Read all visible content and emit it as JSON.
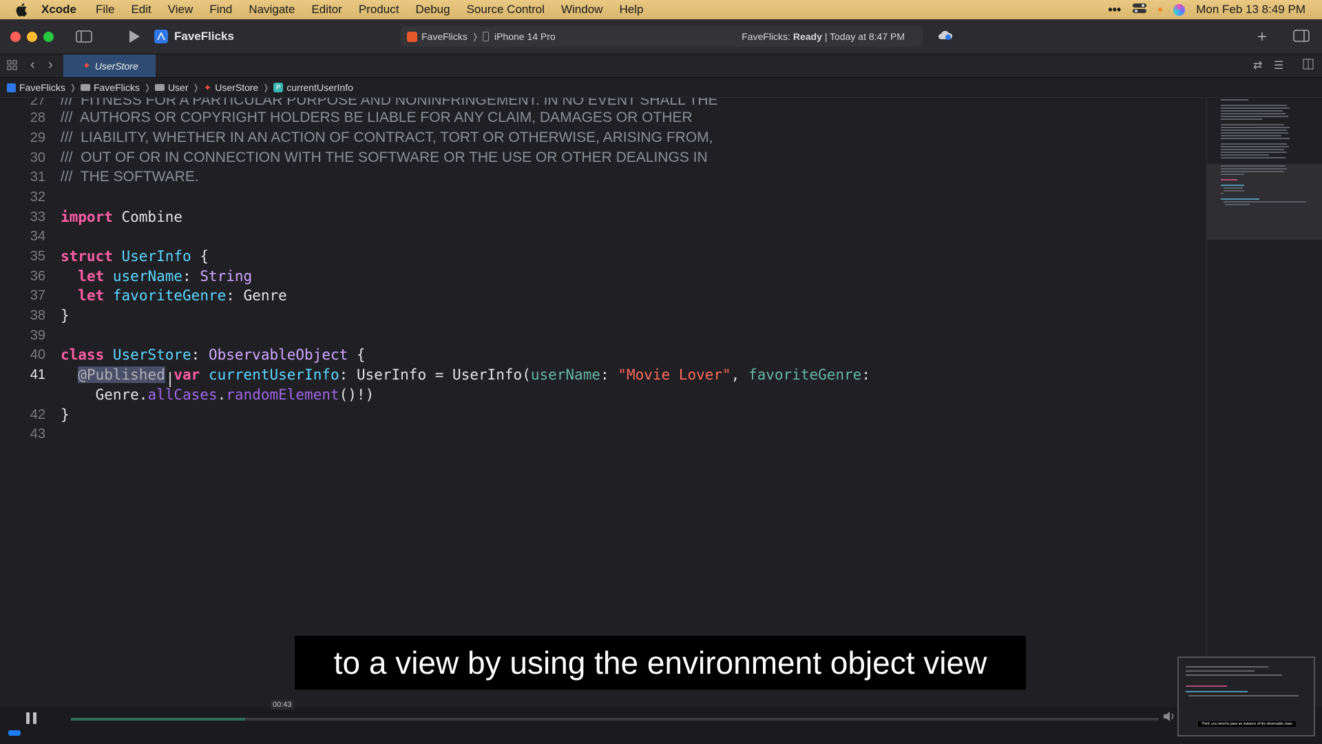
{
  "menubar": {
    "app_name": "Xcode",
    "items": [
      "File",
      "Edit",
      "View",
      "Find",
      "Navigate",
      "Editor",
      "Product",
      "Debug",
      "Source Control",
      "Window",
      "Help"
    ],
    "clock": "Mon Feb 13  8:49 PM"
  },
  "toolbar": {
    "project_title": "FaveFlicks",
    "scheme": "FaveFlicks",
    "device": "iPhone 14 Pro",
    "status_prefix": "FaveFlicks: ",
    "status_state": "Ready",
    "status_time": " | Today at 8:47 PM"
  },
  "tabs": [
    {
      "label": "UserStore",
      "active": true
    }
  ],
  "jumpbar": {
    "items": [
      "FaveFlicks",
      "FaveFlicks",
      "User",
      "UserStore",
      "currentUserInfo"
    ]
  },
  "editor": {
    "lines": [
      {
        "num": "27",
        "text": "///  FITNESS FOR A PARTICULAR PURPOSE AND NONINFRINGEMENT. IN NO EVENT SHALL THE"
      },
      {
        "num": "28",
        "text": "///  AUTHORS OR COPYRIGHT HOLDERS BE LIABLE FOR ANY CLAIM, DAMAGES OR OTHER"
      },
      {
        "num": "29",
        "text": "///  LIABILITY, WHETHER IN AN ACTION OF CONTRACT, TORT OR OTHERWISE, ARISING FROM,"
      },
      {
        "num": "30",
        "text": "///  OUT OF OR IN CONNECTION WITH THE SOFTWARE OR THE USE OR OTHER DEALINGS IN"
      },
      {
        "num": "31",
        "text": "///  THE SOFTWARE."
      },
      {
        "num": "32"
      },
      {
        "num": "33",
        "kw": "import",
        "rest": " Combine"
      },
      {
        "num": "34"
      },
      {
        "num": "35",
        "kw": "struct",
        "name": "UserInfo",
        "rest": " {"
      },
      {
        "num": "36",
        "kw": "let",
        "prop": "userName",
        "type": "String"
      },
      {
        "num": "37",
        "kw": "let",
        "prop": "favoriteGenre",
        "type": "Genre"
      },
      {
        "num": "38",
        "text": "}"
      },
      {
        "num": "39"
      },
      {
        "num": "40",
        "kw": "class",
        "name": "UserStore",
        "conform": "ObservableObject",
        "rest": " {"
      },
      {
        "num": "41",
        "attr": "@Published",
        "kw": "var",
        "prop": "currentUserInfo",
        "type": "UserInfo",
        "init": "UserInfo",
        "arg1": "userName",
        "str": "\"Movie Lover\"",
        "arg2": "favoriteGenre"
      },
      {
        "num": "",
        "genre": "Genre",
        "cases": "allCases",
        "call": "randomElement",
        "tail": "()!)"
      },
      {
        "num": "42",
        "text": "}"
      },
      {
        "num": "43"
      }
    ]
  },
  "subtitle": "to a view by using the environment object view",
  "player": {
    "timecode": "00:43",
    "progress": 0.16,
    "preview_caption": "Third, you need to pass an instance of the observable class"
  },
  "colors": {
    "menubar": "#dfbd74",
    "keyword": "#fc5fa3",
    "type": "#5dd8ff",
    "string": "#fc6a5d",
    "comment": "#8d9097"
  }
}
